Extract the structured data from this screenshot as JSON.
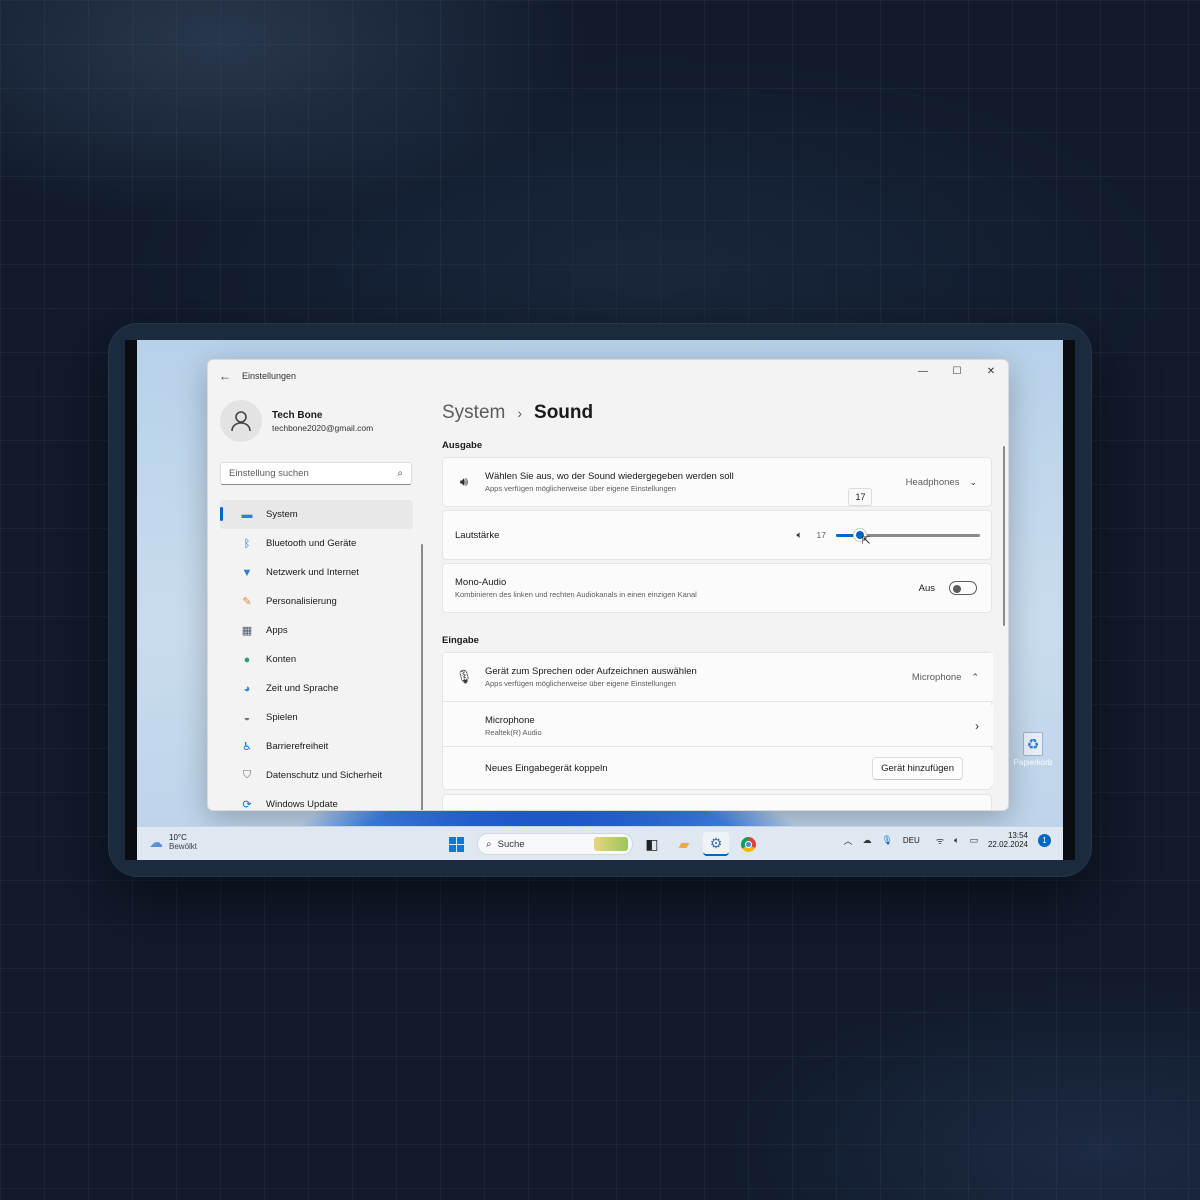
{
  "window": {
    "title": "Einstellungen",
    "controls": {
      "minimize": "—",
      "maximize": "☐",
      "close": "✕"
    }
  },
  "profile": {
    "name": "Tech Bone",
    "email": "techbone2020@gmail.com"
  },
  "search": {
    "placeholder": "Einstellung suchen"
  },
  "sidebar": {
    "items": [
      {
        "label": "System",
        "icon": "monitor-icon",
        "active": true
      },
      {
        "label": "Bluetooth und Geräte",
        "icon": "bluetooth-icon"
      },
      {
        "label": "Netzwerk und Internet",
        "icon": "wifi-icon"
      },
      {
        "label": "Personalisierung",
        "icon": "brush-icon"
      },
      {
        "label": "Apps",
        "icon": "apps-icon"
      },
      {
        "label": "Konten",
        "icon": "person-icon"
      },
      {
        "label": "Zeit und Sprache",
        "icon": "globe-clock-icon"
      },
      {
        "label": "Spielen",
        "icon": "gamepad-icon"
      },
      {
        "label": "Barrierefreiheit",
        "icon": "accessibility-icon"
      },
      {
        "label": "Datenschutz und Sicherheit",
        "icon": "shield-icon"
      },
      {
        "label": "Windows Update",
        "icon": "update-icon"
      }
    ]
  },
  "breadcrumb": {
    "parent": "System",
    "separator": "›",
    "current": "Sound"
  },
  "output": {
    "heading": "Ausgabe",
    "device_select": {
      "title": "Wählen Sie aus, wo der Sound wiedergegeben werden soll",
      "subtitle": "Apps verfügen möglicherweise über eigene Einstellungen",
      "value": "Headphones"
    },
    "volume": {
      "label": "Lautstärke",
      "value": 17,
      "display": "17",
      "tooltip": "17",
      "max": 100
    },
    "mono": {
      "title": "Mono-Audio",
      "subtitle": "Kombinieren des linken und rechten Audiokanals in einen einzigen Kanal",
      "state": "Aus"
    }
  },
  "input": {
    "heading": "Eingabe",
    "device_select": {
      "title": "Gerät zum Sprechen oder Aufzeichnen auswählen",
      "subtitle": "Apps verfügen möglicherweise über eigene Einstellungen",
      "value": "Microphone"
    },
    "microphone": {
      "name": "Microphone",
      "driver": "Realtek(R) Audio"
    },
    "pair": {
      "label": "Neues Eingabegerät koppeln",
      "button": "Gerät hinzufügen"
    }
  },
  "desktop": {
    "recycle_label": "Papierkorb"
  },
  "taskbar": {
    "weather": {
      "temp": "10°C",
      "condition": "Bewölkt"
    },
    "search_label": "Suche",
    "language": "DEU",
    "time": "13:54",
    "date": "22.02.2024",
    "notifications": "1"
  },
  "colors": {
    "accent": "#0067c0",
    "window_bg": "#f3f3f3",
    "card_bg": "#fbfbfb"
  }
}
